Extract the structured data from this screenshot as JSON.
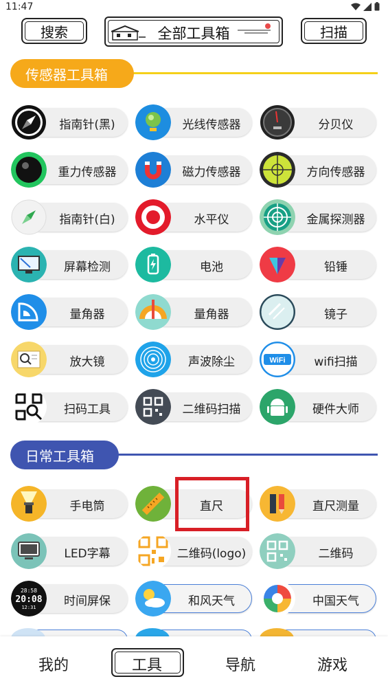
{
  "status_bar": {
    "time": "11:47"
  },
  "top_nav": {
    "search_label": "搜索",
    "title": "全部工具箱",
    "scan_label": "扫描"
  },
  "sections": [
    {
      "title": "传感器工具箱",
      "color": "#f6a91a",
      "line_color": "#f5d019",
      "tools": [
        {
          "label": "指南针(黑)",
          "icon": "compass-black-icon"
        },
        {
          "label": "光线传感器",
          "icon": "light-sensor-icon"
        },
        {
          "label": "分贝仪",
          "icon": "decibel-meter-icon"
        },
        {
          "label": "重力传感器",
          "icon": "gravity-sensor-icon"
        },
        {
          "label": "磁力传感器",
          "icon": "magnet-icon"
        },
        {
          "label": "方向传感器",
          "icon": "direction-sensor-icon"
        },
        {
          "label": "指南针(白)",
          "icon": "compass-white-icon"
        },
        {
          "label": "水平仪",
          "icon": "level-target-icon"
        },
        {
          "label": "金属探测器",
          "icon": "metal-detector-icon"
        },
        {
          "label": "屏幕检测",
          "icon": "screen-test-icon"
        },
        {
          "label": "电池",
          "icon": "battery-icon"
        },
        {
          "label": "铅锤",
          "icon": "plumb-bob-icon"
        },
        {
          "label": "量角器",
          "icon": "protractor-icon"
        },
        {
          "label": "量角器",
          "icon": "protractor-ruler-icon"
        },
        {
          "label": "镜子",
          "icon": "mirror-icon"
        },
        {
          "label": "放大镜",
          "icon": "magnifier-icon"
        },
        {
          "label": "声波除尘",
          "icon": "sound-wave-icon"
        },
        {
          "label": "wifi扫描",
          "icon": "wifi-icon"
        },
        {
          "label": "扫码工具",
          "icon": "qr-scan-icon"
        },
        {
          "label": "二维码扫描",
          "icon": "qr-code-icon"
        },
        {
          "label": "硬件大师",
          "icon": "android-icon"
        }
      ]
    },
    {
      "title": "日常工具箱",
      "color": "#3f55b0",
      "line_color": "#3f55b0",
      "tools": [
        {
          "label": "手电筒",
          "icon": "flashlight-icon"
        },
        {
          "label": "直尺",
          "icon": "ruler-icon"
        },
        {
          "label": "直尺测量",
          "icon": "ruler-pencil-icon"
        },
        {
          "label": "LED字幕",
          "icon": "monitor-icon"
        },
        {
          "label": "二维码(logo)",
          "icon": "qr-logo-icon"
        },
        {
          "label": "二维码",
          "icon": "qr-generate-icon"
        },
        {
          "label": "时间屏保",
          "icon": "digital-clock-icon"
        },
        {
          "label": "和风天气",
          "icon": "weather-icon"
        },
        {
          "label": "中国天气",
          "icon": "china-weather-icon"
        }
      ]
    }
  ],
  "bottom_nav": {
    "items": [
      "我的",
      "工具",
      "导航",
      "游戏"
    ],
    "active_index": 1
  }
}
